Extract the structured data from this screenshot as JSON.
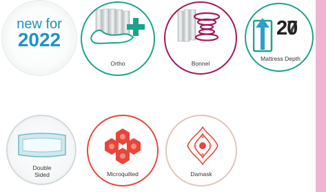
{
  "promo": {
    "line1": "new for",
    "line2": "2022"
  },
  "features": [
    {
      "label": "Ortho",
      "icon": "ortho-spring-plus-icon",
      "ring_color": "#1aa38b"
    },
    {
      "label": "Bonnel",
      "icon": "bonnel-coil-spring-icon",
      "ring_color": "#a0185a"
    },
    {
      "label": "Mattress Depth",
      "depth_values": [
        "27",
        "20"
      ],
      "icon": "mattress-depth-arrow-icon",
      "ring_color": "#1aa38b"
    },
    {
      "label": "Double Sided",
      "icon": "double-sided-mattress-icon",
      "ring_color": "#d3d8da"
    },
    {
      "label": "Microquilted",
      "icon": "microquilted-pattern-icon",
      "ring_color": "#e8463a"
    },
    {
      "label": "Damask",
      "icon": "damask-pattern-icon",
      "ring_color": "#e0c5bd"
    }
  ],
  "accent_bar_color": "#f2b3d2"
}
